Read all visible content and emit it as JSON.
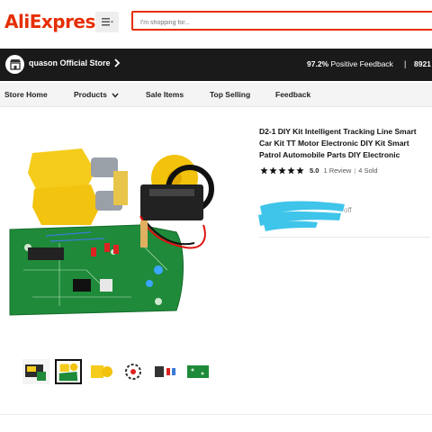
{
  "header": {
    "logo_text": "AliExpress",
    "logo_color": "#e62e04",
    "menu_icon": "hamburger-menu-icon",
    "search_placeholder": "I'm shopping for..."
  },
  "store": {
    "name": "quason Official Store",
    "positive_pct": "97.2%",
    "positive_label": "Positive Feedback",
    "divider": "|",
    "followers": "8921"
  },
  "nav": {
    "items": [
      "Store Home",
      "Products",
      "Sale Items",
      "Top Selling",
      "Feedback"
    ]
  },
  "product": {
    "title": "D2-1 DIY Kit Intelligent Tracking Line Smart Car Kit TT Motor Electronic DIY Kit Smart Patrol Automobile Parts DIY Electronic",
    "rating": "5.0",
    "reviews": "1 Review",
    "sep": "|",
    "sold": "4 Sold",
    "stars_filled": 5,
    "price_off_suffix": "off",
    "thumbnail_count": 6,
    "active_thumbnail": 2
  },
  "colors": {
    "accent": "#e62e04",
    "store_bar": "#1a1a1a",
    "redaction": "#3fc4ea",
    "pcb_green": "#1f8a3a",
    "motor_yellow": "#f5cc1b"
  }
}
